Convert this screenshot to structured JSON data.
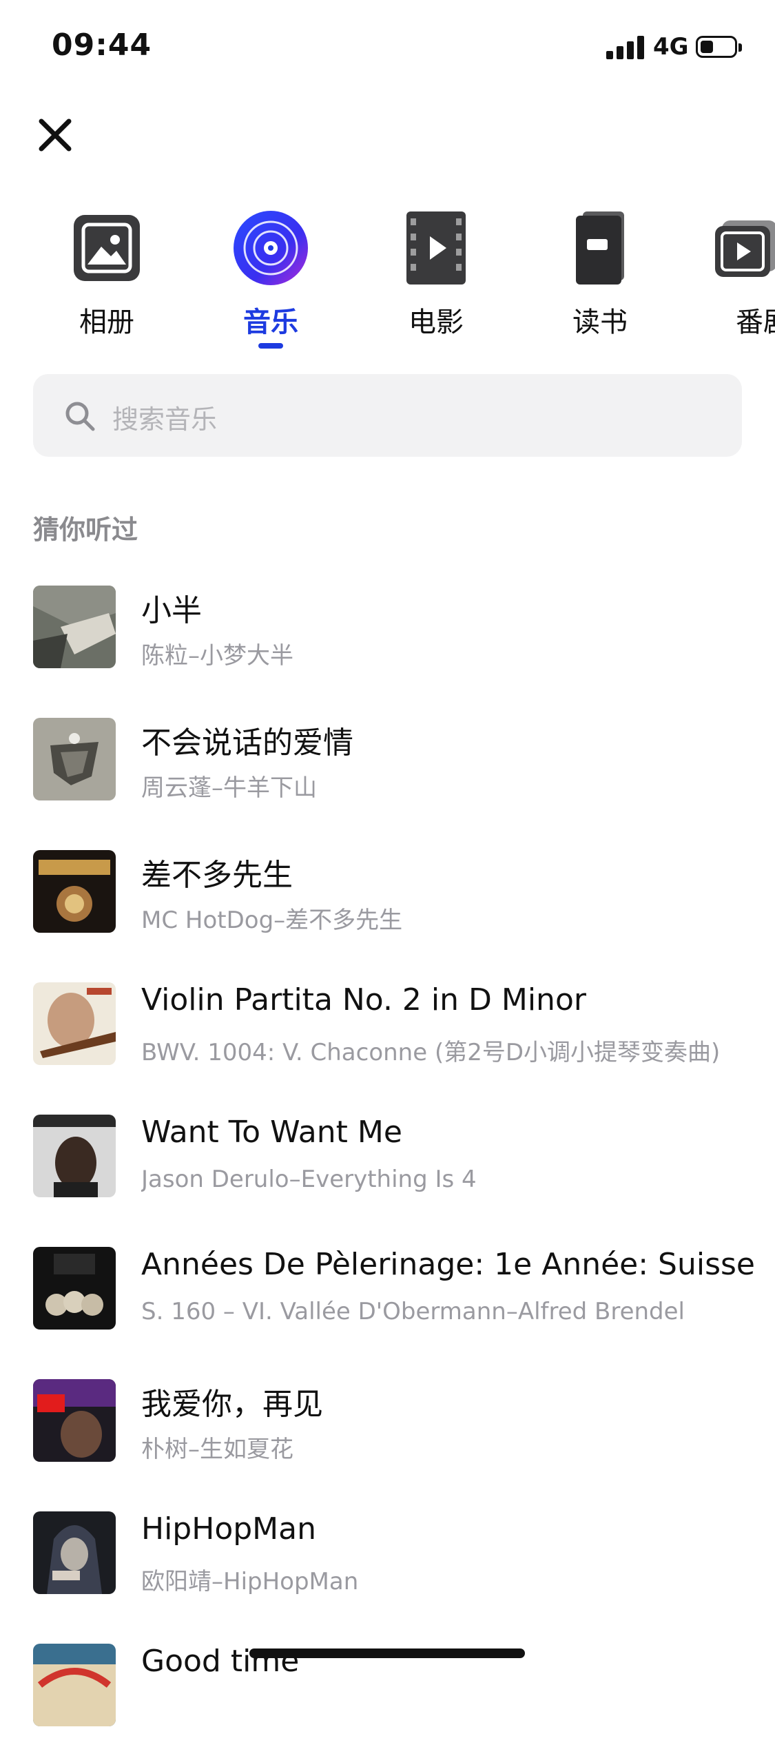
{
  "status_bar": {
    "time": "09:44",
    "network": "4G"
  },
  "tabs": [
    {
      "label": "相册",
      "icon": "photo-album-icon",
      "active": false
    },
    {
      "label": "音乐",
      "icon": "music-disc-icon",
      "active": true
    },
    {
      "label": "电影",
      "icon": "film-icon",
      "active": false
    },
    {
      "label": "读书",
      "icon": "book-icon",
      "active": false
    },
    {
      "label": "番剧",
      "icon": "video-icon",
      "active": false
    }
  ],
  "search": {
    "placeholder": "搜索音乐"
  },
  "section": {
    "title": "猜你听过"
  },
  "songs": [
    {
      "title": "小半",
      "subtitle": "陈粒–小梦大半"
    },
    {
      "title": "不会说话的爱情",
      "subtitle": "周云蓬–牛羊下山"
    },
    {
      "title": "差不多先生",
      "subtitle": "MC HotDog–差不多先生"
    },
    {
      "title": "Violin Partita No. 2 in D Minor",
      "subtitle": " BWV. 1004: V. Chaconne (第2号D小调小提琴变奏曲)"
    },
    {
      "title": "Want To Want Me",
      "subtitle": "Jason Derulo–Everything Is 4"
    },
    {
      "title": "Années De Pèlerinage: 1e Année: Suisse",
      "subtitle": " S. 160 – VI. Vallée D'Obermann–Alfred Brendel"
    },
    {
      "title": "我爱你，再见",
      "subtitle": "朴树–生如夏花"
    },
    {
      "title": "HipHopMan",
      "subtitle": "欧阳靖–HipHopMan"
    },
    {
      "title": "Good time",
      "subtitle": ""
    }
  ],
  "colors": {
    "accent": "#1d3be0",
    "muted": "#9a9aa0",
    "search_bg": "#f2f2f3"
  }
}
